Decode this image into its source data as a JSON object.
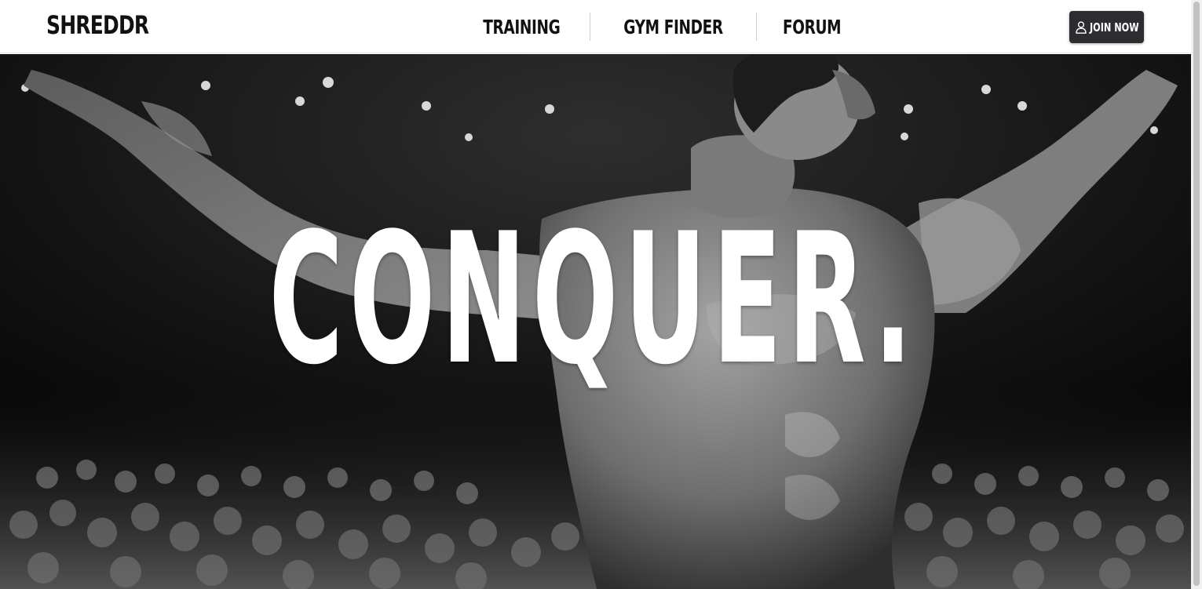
{
  "header": {
    "brand": "SHREDDR",
    "nav": [
      {
        "label": "TRAINING"
      },
      {
        "label": "GYM FINDER"
      },
      {
        "label": "FORUM"
      }
    ],
    "join_button": {
      "label": "JOIN NOW",
      "icon": "user-icon"
    }
  },
  "hero": {
    "headline": "CONQUER.",
    "image": "bodybuilder-on-stage-photo"
  },
  "colors": {
    "navbar_bg": "#ffffff",
    "text_dark": "#111111",
    "button_bg": "#2d2d31",
    "button_text": "#ffffff",
    "hero_text": "#ffffff"
  }
}
